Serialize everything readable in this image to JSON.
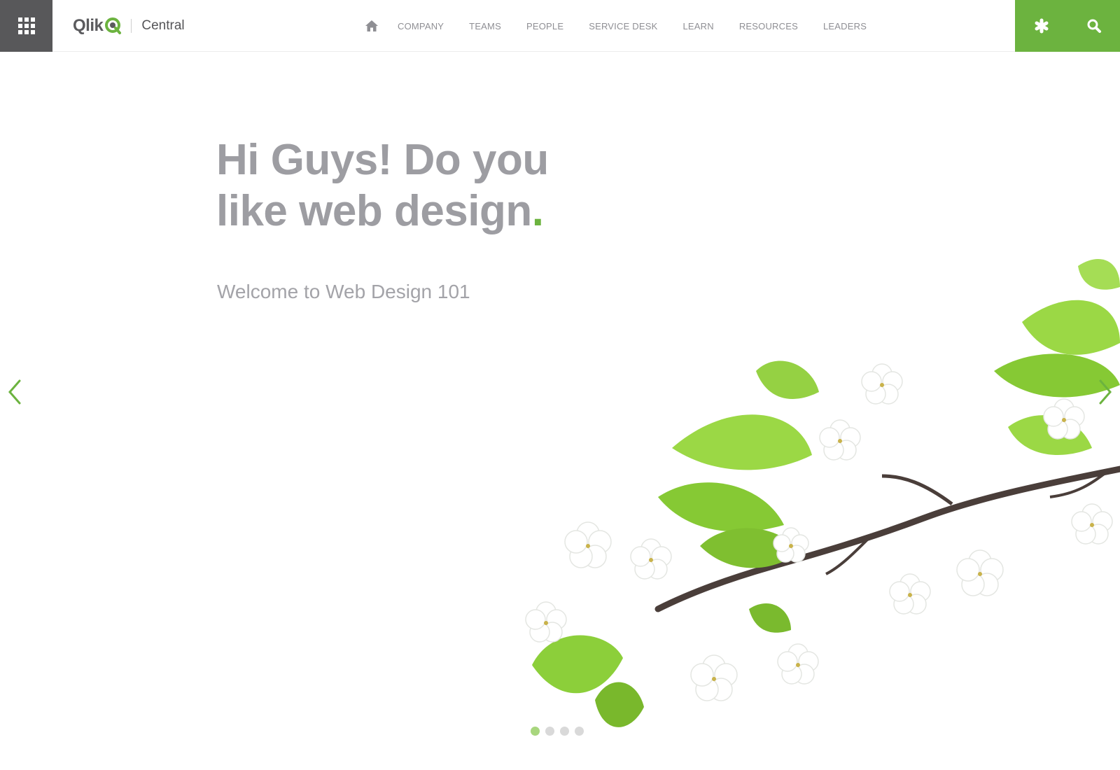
{
  "header": {
    "logo": {
      "word": "Qlik",
      "product": "Central"
    },
    "nav": {
      "home_icon": "home-icon",
      "items": [
        {
          "label": "COMPANY"
        },
        {
          "label": "TEAMS"
        },
        {
          "label": "PEOPLE"
        },
        {
          "label": "SERVICE DESK"
        },
        {
          "label": "LEARN"
        },
        {
          "label": "RESOURCES"
        },
        {
          "label": "LEADERS"
        }
      ]
    },
    "apps_icon": "grid-icon",
    "utility": [
      {
        "icon": "asterisk-icon"
      },
      {
        "icon": "search-icon"
      }
    ]
  },
  "hero": {
    "title_line1": "Hi Guys! Do you",
    "title_line2": "like web design",
    "title_dot": ".",
    "subtitle": "Welcome to Web Design 101",
    "slides": 4,
    "active_slide": 1
  },
  "colors": {
    "accent": "#6cb33f",
    "apps_bg": "#58585a",
    "text": "#9d9da2"
  }
}
